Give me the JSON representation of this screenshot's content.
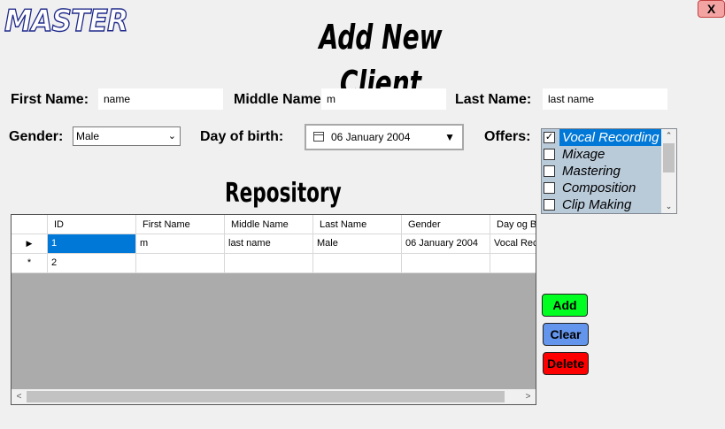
{
  "brand": {
    "logo_text": "MASTER"
  },
  "window": {
    "close_label": "X"
  },
  "header": {
    "title": "Add New Client"
  },
  "form": {
    "first_name_label": "First Name:",
    "first_name_value": "name",
    "middle_name_label": "Middle Name",
    "middle_name_value": "m",
    "last_name_label": "Last Name:",
    "last_name_value": "last name",
    "gender_label": "Gender:",
    "gender_value": "Male",
    "dob_label": "Day of birth:",
    "dob_value": "06 January 2004",
    "offers_label": "Offers:",
    "offers": [
      {
        "label": "Vocal Recording",
        "checked": true,
        "selected": true
      },
      {
        "label": "Mixage",
        "checked": false,
        "selected": false
      },
      {
        "label": "Mastering",
        "checked": false,
        "selected": false
      },
      {
        "label": "Composition",
        "checked": false,
        "selected": false
      },
      {
        "label": "Clip Making",
        "checked": false,
        "selected": false
      }
    ]
  },
  "repository": {
    "title": "Repository",
    "columns": [
      "ID",
      "First Name",
      "Middle Name",
      "Last Name",
      "Gender",
      "Day og Birth"
    ],
    "rows": [
      [
        "1",
        "m",
        "last name",
        "Male",
        "06 January 2004",
        "Vocal Recording"
      ],
      [
        "2",
        "",
        "",
        "",
        "",
        ""
      ]
    ]
  },
  "actions": {
    "add_label": "Add",
    "clear_label": "Clear",
    "delete_label": "Delete",
    "add_color": "#00ff21",
    "clear_color": "#6495ed",
    "delete_color": "#ff0000"
  }
}
